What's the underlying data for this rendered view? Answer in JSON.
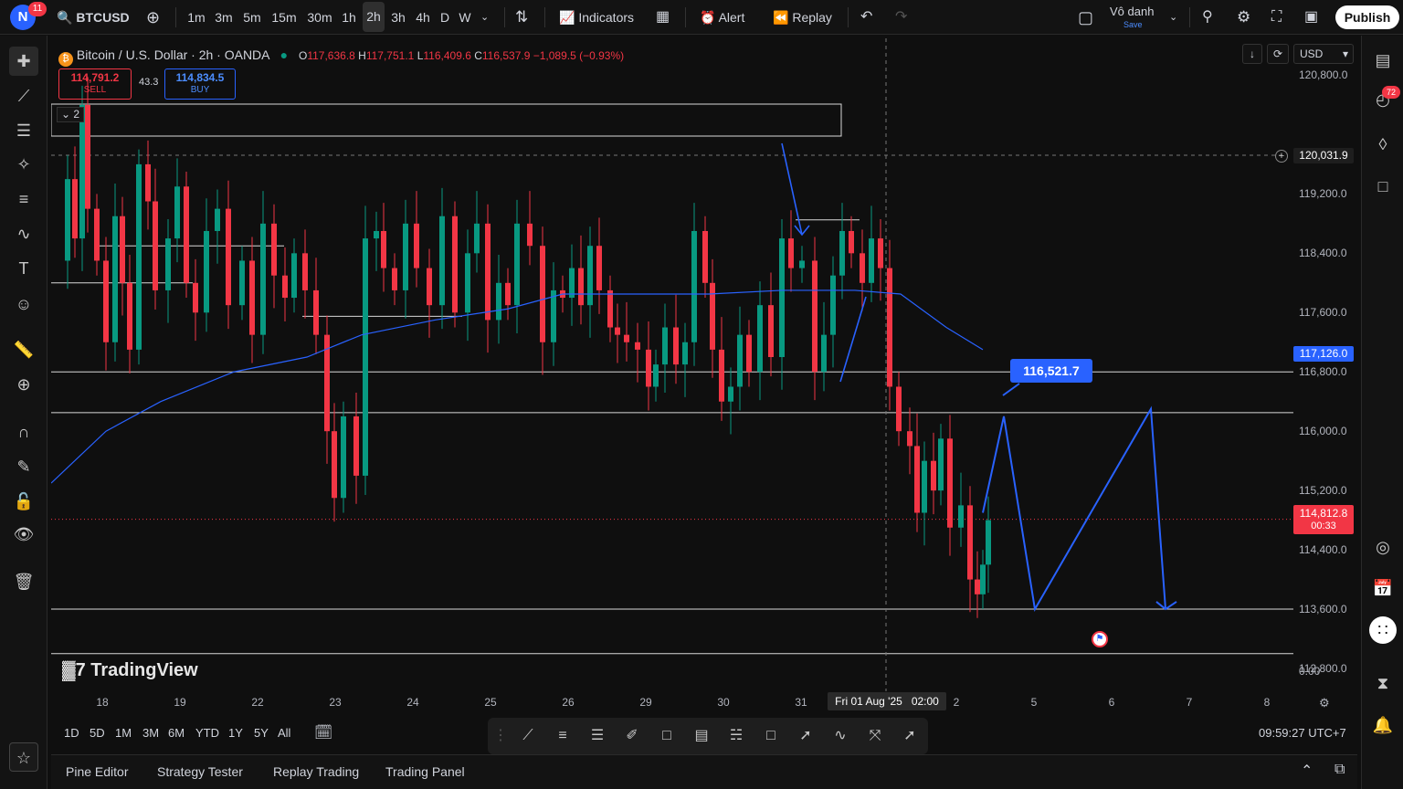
{
  "topbar": {
    "avatar_letter": "N",
    "avatar_badge": "11",
    "symbol": "BTCUSD",
    "timeframes": [
      "1m",
      "3m",
      "5m",
      "15m",
      "30m",
      "1h",
      "2h",
      "3h",
      "4h",
      "D",
      "W"
    ],
    "active_timeframe": "2h",
    "indicators_label": "Indicators",
    "alert_label": "Alert",
    "replay_label": "Replay",
    "layout_name": "Vô danh",
    "layout_save": "Save",
    "publish_label": "Publish"
  },
  "legend": {
    "title": "Bitcoin / U.S. Dollar · 2h · OANDA",
    "open_label": "O",
    "open": "117,636.8",
    "high_label": "H",
    "high": "117,751.1",
    "low_label": "L",
    "low": "116,409.6",
    "close_label": "C",
    "close": "116,537.9",
    "change": "−1,089.5 (−0.93%)",
    "sell_price": "114,791.2",
    "sell_label": "SELL",
    "spread": "43.3",
    "buy_price": "114,834.5",
    "buy_label": "BUY",
    "collapse": "2"
  },
  "axis": {
    "currency": "USD",
    "price_labels": [
      "120,800.0",
      "119,200.0",
      "118,400.0",
      "117,600.0",
      "116,800.0",
      "116,000.0",
      "115,200.0",
      "114,400.0",
      "113,600.0",
      "112,800.0"
    ],
    "zero_label": "0.00",
    "crosshair_price": "120,031.9",
    "ma_price": "117,126.0",
    "last_price": "114,812.8",
    "countdown": "00:33",
    "date_labels": [
      "18",
      "19",
      "22",
      "23",
      "24",
      "25",
      "26",
      "29",
      "30",
      "31",
      "2",
      "5",
      "6",
      "7",
      "8"
    ],
    "crosshair_date": "Fri 01 Aug '25",
    "crosshair_time": "02:00",
    "projection_label": "116,521.7",
    "watermark": "TradingView"
  },
  "chart_data": {
    "type": "candlestick",
    "symbol": "BTCUSD",
    "timeframe": "2h",
    "y_range": [
      112800,
      121200
    ],
    "moving_average_color": "#2962ff",
    "up_color": "#089981",
    "down_color": "#f23645",
    "horizontal_levels": [
      116800,
      116250,
      113600,
      113000
    ],
    "projection_path": [
      116200,
      113600,
      116300,
      113600
    ]
  },
  "colors": {
    "accent": "#2962ff",
    "up": "#089981",
    "down": "#f23645",
    "bg": "#0f0f0f"
  },
  "rangebar": {
    "ranges": [
      "1D",
      "5D",
      "1M",
      "3M",
      "6M",
      "YTD",
      "1Y",
      "5Y",
      "All"
    ],
    "clock": "09:59:27 UTC+7"
  },
  "panels": [
    "Pine Editor",
    "Strategy Tester",
    "Replay Trading",
    "Trading Panel"
  ],
  "right_toolbar": {
    "notification_count": "72"
  }
}
